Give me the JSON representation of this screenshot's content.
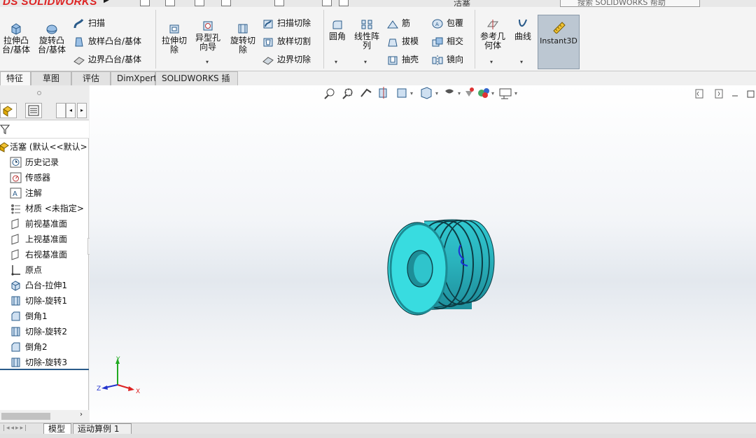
{
  "app": {
    "logo_prefix": "DS",
    "logo_text": "SOLIDWORKS",
    "document_title": "活塞",
    "help_search_placeholder": "搜索 SOLIDWORKS 帮助"
  },
  "ribbon": {
    "extrude_boss": "拉伸凸\n台/基体",
    "revolve_boss": "旋转凸\n台/基体",
    "sweep": "扫描",
    "loft_boss": "放样凸台/基体",
    "boundary_boss": "边界凸台/基体",
    "extrude_cut": "拉伸切\n除",
    "hole_wizard": "异型孔\n向导",
    "revolve_cut": "旋转切\n除",
    "swept_cut": "扫描切除",
    "lofted_cut": "放样切割",
    "boundary_cut": "边界切除",
    "fillet": "圆角",
    "linear_pattern": "线性阵\n列",
    "rib": "筋",
    "draft": "拔模",
    "shell": "抽壳",
    "wrap": "包覆",
    "intersect": "相交",
    "mirror": "镜向",
    "reference_geometry": "参考几\n何体",
    "curves": "曲线",
    "instant3d": "Instant3D"
  },
  "command_tabs": [
    {
      "label": "特征",
      "active": true
    },
    {
      "label": "草图",
      "active": false
    },
    {
      "label": "评估",
      "active": false
    },
    {
      "label": "DimXpert",
      "active": false
    },
    {
      "label": "SOLIDWORKS 插件",
      "active": false
    }
  ],
  "feature_tree": {
    "root": "活塞 (默认<<默认>",
    "items": [
      {
        "label": "历史记录",
        "icon": "history-icon"
      },
      {
        "label": "传感器",
        "icon": "sensor-icon"
      },
      {
        "label": "注解",
        "icon": "annotation-icon"
      },
      {
        "label": "材质 <未指定>",
        "icon": "material-icon"
      },
      {
        "label": "前视基准面",
        "icon": "plane-icon"
      },
      {
        "label": "上视基准面",
        "icon": "plane-icon"
      },
      {
        "label": "右视基准面",
        "icon": "plane-icon"
      },
      {
        "label": "原点",
        "icon": "origin-icon"
      },
      {
        "label": "凸台-拉伸1",
        "icon": "extrude-icon"
      },
      {
        "label": "切除-旋转1",
        "icon": "revolve-cut-icon"
      },
      {
        "label": "倒角1",
        "icon": "chamfer-icon"
      },
      {
        "label": "切除-旋转2",
        "icon": "revolve-cut-icon"
      },
      {
        "label": "倒角2",
        "icon": "chamfer-icon"
      },
      {
        "label": "切除-旋转3",
        "icon": "revolve-cut-icon"
      }
    ]
  },
  "triad": {
    "x": "X",
    "y": "Y",
    "z": "Z"
  },
  "bottom_tabs": [
    {
      "label": "模型",
      "active": true
    },
    {
      "label": "运动算例 1",
      "active": false
    }
  ],
  "colors": {
    "part_face": "#2fd6d6",
    "part_shade": "#1f9ea7",
    "instant3d_bg": "#bcc7d2",
    "logo_red": "#dd2222"
  }
}
